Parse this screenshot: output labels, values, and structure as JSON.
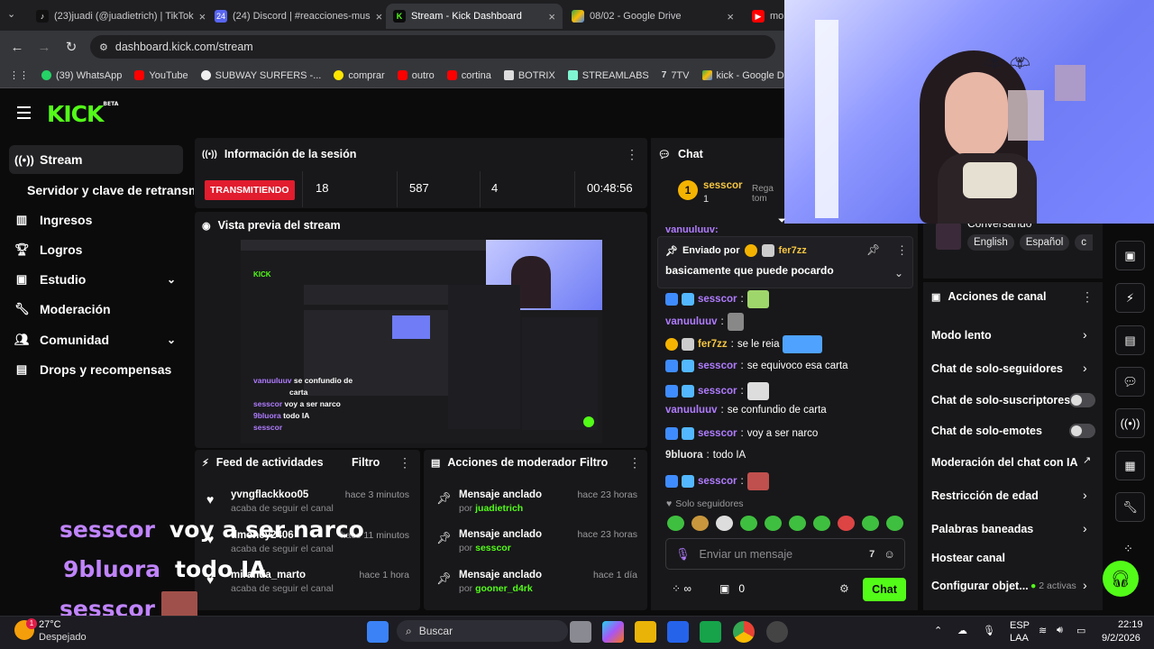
{
  "tabs": [
    {
      "label": "(23)juadi (@juadietrich) | TikTok",
      "icon": "tiktok-icon"
    },
    {
      "label": "(24) Discord | #reacciones-mus",
      "icon": "discord-icon"
    },
    {
      "label": "Stream - Kick Dashboard",
      "icon": "kick-icon"
    },
    {
      "label": "08/02 - Google Drive",
      "icon": "drive-icon"
    },
    {
      "label": "mo",
      "icon": "youtube-icon"
    }
  ],
  "address": {
    "url": "dashboard.kick.com/stream"
  },
  "bookmarks": [
    "(39) WhatsApp",
    "YouTube",
    "SUBWAY SURFERS -...",
    "comprar",
    "outro",
    "cortina",
    "BOTRIX",
    "STREAMLABS",
    "7TV",
    "kick - Google Drive"
  ],
  "kick": {
    "logo": "KICK",
    "beta": "BETA"
  },
  "sidebar": {
    "items": [
      {
        "label": "Stream"
      },
      {
        "label": "Servidor y clave de retransm"
      },
      {
        "label": "Ingresos"
      },
      {
        "label": "Logros"
      },
      {
        "label": "Estudio"
      },
      {
        "label": "Moderación"
      },
      {
        "label": "Comunidad"
      },
      {
        "label": "Drops y recompensas"
      }
    ]
  },
  "session": {
    "title": "Información de la sesión",
    "status": "TRANSMITIENDO",
    "viewers": "18",
    "followers": "587",
    "subs": "4",
    "time": "00:48:56"
  },
  "preview": {
    "title": "Vista previa del stream"
  },
  "feed": {
    "title": "Feed de actividades",
    "filter": "Filtro",
    "items": [
      {
        "user": "yvngflackkoo05",
        "sub": "acaba de seguir el canal",
        "time": "hace 3 minutos"
      },
      {
        "user": "dmoney2406",
        "sub": "acaba de seguir el canal",
        "time": "hace 11 minutos"
      },
      {
        "user": "miranda_marto",
        "sub": "acaba de seguir el canal",
        "time": "hace 1 hora"
      }
    ]
  },
  "modactions": {
    "title": "Acciones de moderador",
    "filter": "Filtro",
    "items": [
      {
        "label": "Mensaje anclado",
        "by": "por",
        "user": "juadietrich",
        "time": "hace 23 horas"
      },
      {
        "label": "Mensaje anclado",
        "by": "por",
        "user": "sesscor",
        "time": "hace 23 horas"
      },
      {
        "label": "Mensaje anclado",
        "by": "por",
        "user": "gooner_d4rk",
        "time": "hace 1 día"
      }
    ]
  },
  "chat": {
    "title": "Chat",
    "top_user": "sesscor",
    "top_count": "1",
    "top_label": "Rega tom",
    "partial": "vanuuluuv:",
    "pinned": {
      "label": "Enviado por",
      "user": "fer7zz",
      "text": "basicamente que puede pocardo"
    },
    "messages": [
      {
        "user": "sesscor",
        "text": ""
      },
      {
        "user": "vanuuluuv",
        "text": ""
      },
      {
        "user": "fer7zz",
        "text": "se le reia"
      },
      {
        "user": "sesscor",
        "text": "se equivoco esa carta"
      },
      {
        "user": "sesscor",
        "text": ""
      },
      {
        "user": "vanuuluuv",
        "text": "se confundio de carta"
      },
      {
        "user": "sesscor",
        "text": "voy a ser narco"
      },
      {
        "user": "9bluora",
        "text": "todo IA"
      },
      {
        "user": "sesscor",
        "text": ""
      }
    ],
    "followers_only": "Solo seguidores",
    "placeholder": "Enviar un mensaje",
    "points": "0",
    "send": "Chat"
  },
  "stream_info": {
    "category": "Conversando",
    "tags": [
      "English",
      "Español",
      "c"
    ]
  },
  "channel_actions": {
    "title": "Acciones de canal",
    "items": [
      {
        "label": "Modo lento"
      },
      {
        "label": "Chat de solo-seguidores"
      },
      {
        "label": "Chat de solo-suscriptores"
      },
      {
        "label": "Chat de solo-emotes"
      },
      {
        "label": "Moderación del chat con IA"
      },
      {
        "label": "Restricción de edad"
      },
      {
        "label": "Palabras baneadas"
      },
      {
        "label": "Hostear canal"
      },
      {
        "label": "Configurar objet..."
      }
    ],
    "active_count": "2 activas"
  },
  "overlay": [
    {
      "user": "sesscor",
      "text": "voy a ser narco",
      "color": "#c084fc"
    },
    {
      "user": "9bluora",
      "text": "todo IA",
      "color": "#c084fc"
    },
    {
      "user": "sesscor",
      "text": "",
      "color": "#c084fc"
    }
  ],
  "taskbar": {
    "temp": "27°C",
    "weather": "Despejado",
    "search": "Buscar",
    "lang1": "ESP",
    "lang2": "LAA",
    "time": "22:19",
    "date": "9/2/2026",
    "notif": "1"
  },
  "colors": {
    "kick_green": "#53fc18",
    "live_red": "#e11d2e",
    "purple": "#b07cff"
  }
}
